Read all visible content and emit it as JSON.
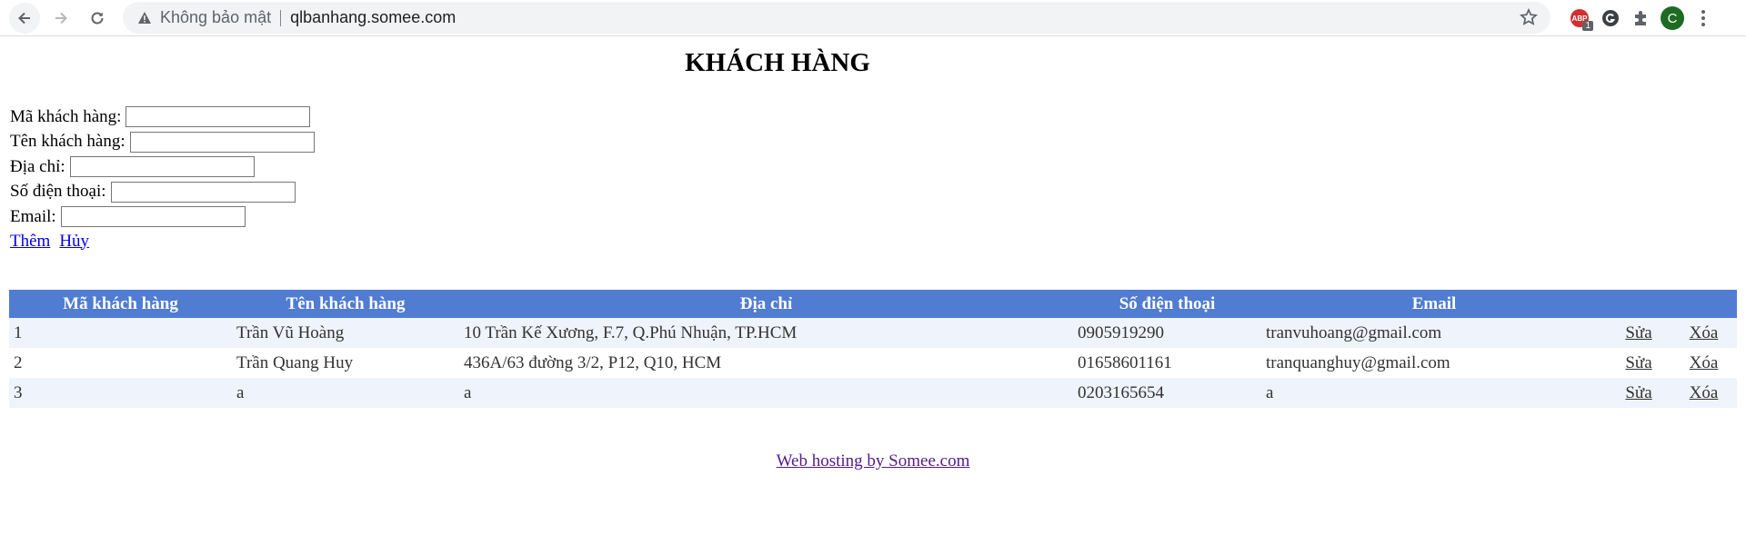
{
  "browser": {
    "security_label": "Không bảo mật",
    "url": "qlbanhang.somee.com",
    "abp_label": "ABP",
    "abp_count": "1",
    "profile_initial": "C"
  },
  "page": {
    "title": "KHÁCH HÀNG"
  },
  "form": {
    "fields": [
      {
        "label": "Mã khách hàng:",
        "value": ""
      },
      {
        "label": "Tên khách hàng:",
        "value": ""
      },
      {
        "label": "Địa chỉ:",
        "value": ""
      },
      {
        "label": "Số điện thoại:",
        "value": ""
      },
      {
        "label": "Email:",
        "value": ""
      }
    ],
    "add_label": "Thêm",
    "cancel_label": "Hủy"
  },
  "table": {
    "headers": [
      "Mã khách hàng",
      "Tên khách hàng",
      "Địa chỉ",
      "Số điện thoại",
      "Email",
      "",
      ""
    ],
    "rows": [
      {
        "id": "1",
        "name": "Trần Vũ Hoàng",
        "address": "10 Trần Kế Xương, F.7, Q.Phú Nhuận, TP.HCM",
        "phone": "0905919290",
        "email": "tranvuhoang@gmail.com",
        "edit": "Sửa",
        "delete": "Xóa"
      },
      {
        "id": "2",
        "name": "Trần Quang Huy",
        "address": "436A/63 đường 3/2, P12, Q10, HCM",
        "phone": "01658601161",
        "email": "tranquanghuy@gmail.com",
        "edit": "Sửa",
        "delete": "Xóa"
      },
      {
        "id": "3",
        "name": "a",
        "address": "a",
        "phone": "0203165654",
        "email": "a",
        "edit": "Sửa",
        "delete": "Xóa"
      }
    ]
  },
  "footer": {
    "link": "Web hosting by Somee.com"
  },
  "colors": {
    "header_bg": "#507cd1",
    "row_alt_bg": "#eff3fb",
    "link": "#0000ee",
    "visited_link": "#551a8b"
  }
}
